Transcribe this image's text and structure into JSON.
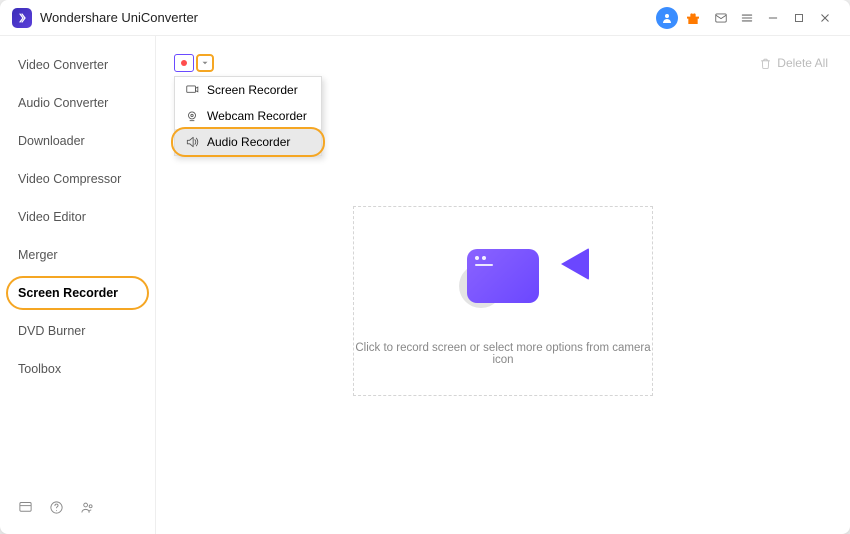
{
  "window": {
    "title": "Wondershare UniConverter"
  },
  "sidebar": {
    "items": [
      {
        "label": "Video Converter"
      },
      {
        "label": "Audio Converter"
      },
      {
        "label": "Downloader"
      },
      {
        "label": "Video Compressor"
      },
      {
        "label": "Video Editor"
      },
      {
        "label": "Merger"
      },
      {
        "label": "Screen Recorder"
      },
      {
        "label": "DVD Burner"
      },
      {
        "label": "Toolbox"
      }
    ],
    "active_index": 6
  },
  "toolbar": {
    "delete_all_label": "Delete All"
  },
  "recorder_dropdown": {
    "items": [
      {
        "label": "Screen Recorder"
      },
      {
        "label": "Webcam Recorder"
      },
      {
        "label": "Audio Recorder"
      }
    ],
    "highlighted_index": 2
  },
  "placeholder": {
    "text": "Click to record screen or select more options from camera icon"
  }
}
